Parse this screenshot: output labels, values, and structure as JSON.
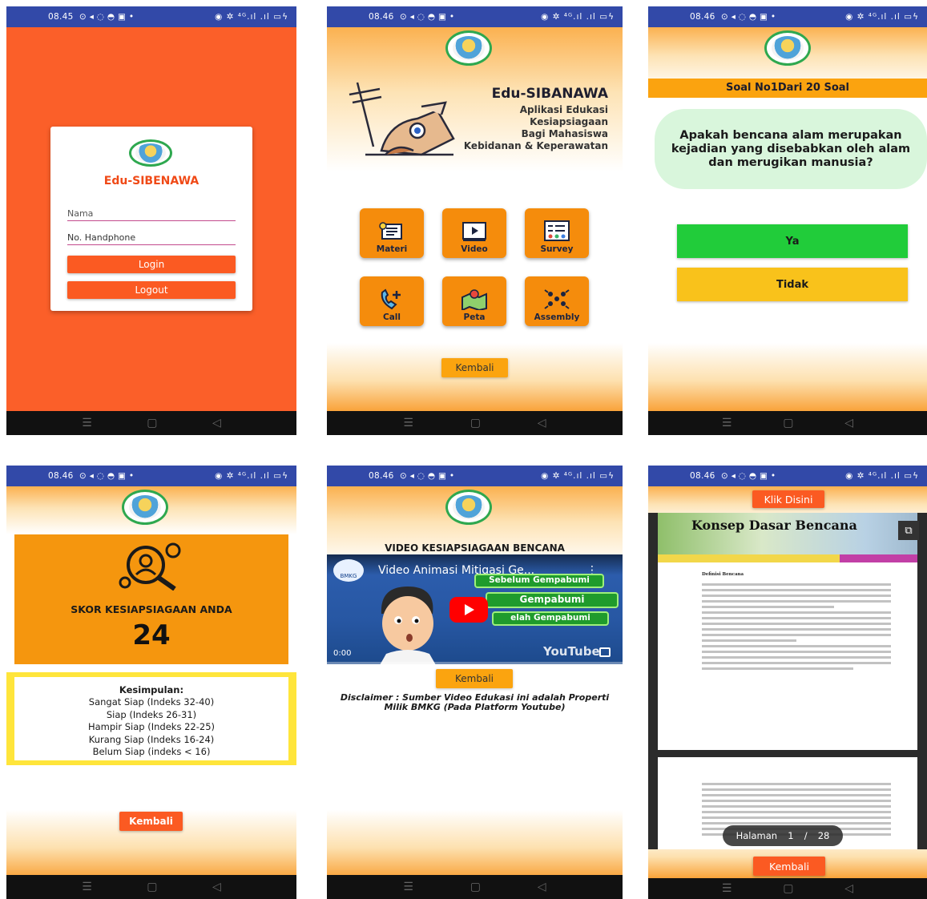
{
  "status": {
    "time_1": "08.45",
    "time_2": "08.46",
    "time_3": "08.46",
    "time_4": "08.46",
    "time_5": "08.46",
    "time_6": "08.46",
    "icons_left": "⊙ ◂ ◌ ◓ ▣ •",
    "icons_right": "◉ ✲ ⁴ᴳ.ıl .ıl ▭ϟ"
  },
  "nav": {
    "menu": "☰",
    "home": "▢",
    "back": "◁"
  },
  "login": {
    "app_name": "Edu-SIBENAWA",
    "name_placeholder": "Nama",
    "phone_placeholder": "No. Handphone",
    "login_label": "Login",
    "logout_label": "Logout"
  },
  "home": {
    "title": "Edu-SIBANAWA",
    "subtitle_1": "Aplikasi Edukasi",
    "subtitle_2": "Kesiapsiagaan",
    "subtitle_3": "Bagi Mahasiswa",
    "subtitle_4": "Kebidanan & Keperawatan",
    "menu": {
      "materi": "Materi",
      "video": "Video",
      "survey": "Survey",
      "call": "Call",
      "peta": "Peta",
      "assembly": "Assembly"
    },
    "back_label": "Kembali"
  },
  "quiz": {
    "header": "Soal No1Dari 20 Soal",
    "question": "Apakah bencana alam merupakan kejadian yang disebabkan oleh alam dan merugikan manusia?",
    "yes_label": "Ya",
    "no_label": "Tidak"
  },
  "score": {
    "title": "SKOR KESIAPSIAGAAN ANDA",
    "value": "24",
    "conclusion_title": "Kesimpulan:",
    "conclusion_lines": [
      "Sangat Siap (Indeks 32-40)",
      "Siap (Indeks 26-31)",
      "Hampir Siap (Indeks 22-25)",
      "Kurang Siap (Indeks 16-24)",
      "Belum Siap (indeks < 16)"
    ],
    "back_label": "Kembali"
  },
  "video": {
    "title": "VIDEO KESIAPSIAGAAN BENCANA",
    "video_title": "Video Animasi Mitigasi Ge...",
    "channel_badge": "BMKG",
    "chip_1": "Sebelum Gempabumi",
    "chip_2": "Gempabumi",
    "chip_3": "elah Gempabumi",
    "time": "0:00",
    "yt_label": "YouTube",
    "back_label": "Kembali",
    "disclaimer": "Disclaimer : Sumber Video Edukasi ini adalah Properti Milik BMKG (Pada Platform Youtube)"
  },
  "doc": {
    "klik_label": "Klik Disini",
    "banner_title": "Konsep Dasar Bencana",
    "section_heading": "Definisi Bencana",
    "page_label": "Halaman",
    "page_current": "1",
    "page_sep": "/",
    "page_total": "28",
    "back_label": "Kembali"
  },
  "colors": {
    "status_bar": "#3249a8",
    "login_bg": "#fb5f29",
    "orange_button": "#fb5a22",
    "amber_button": "#fba40f",
    "tile": "#f58c0c",
    "quiz_yes": "#21cc3a",
    "quiz_no": "#f9c21b",
    "score_yellow": "#ffe53b"
  }
}
